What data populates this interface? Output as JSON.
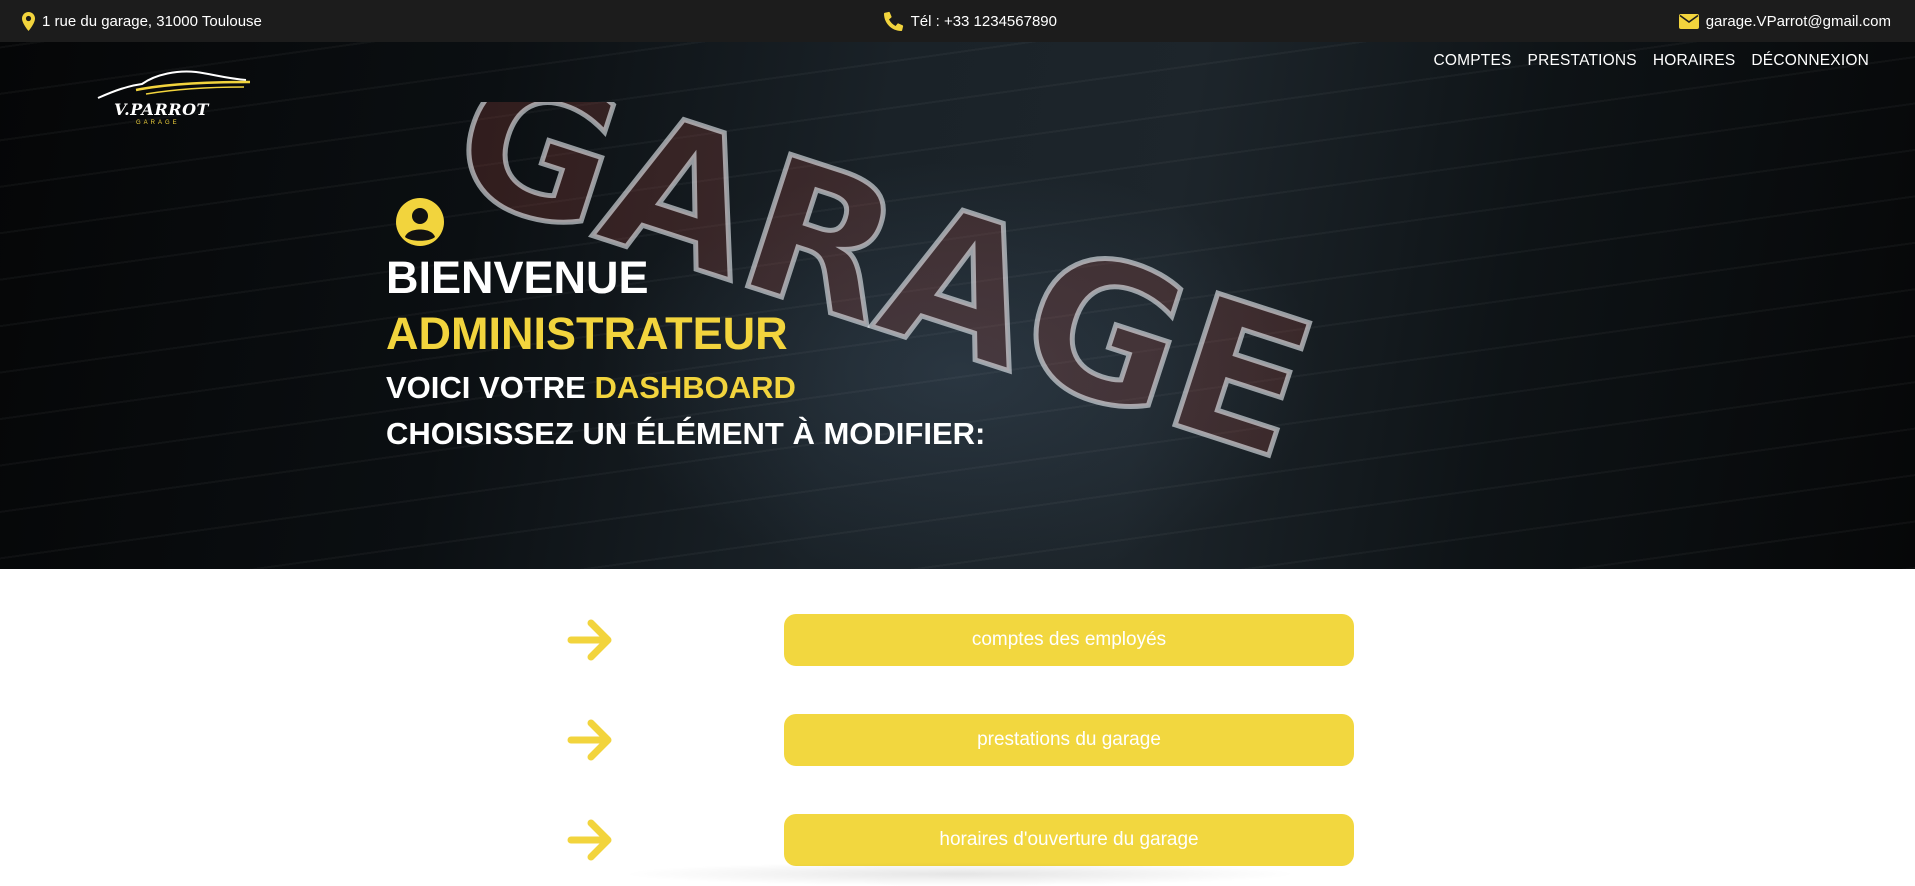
{
  "topbar": {
    "address": "1 rue du garage, 31000 Toulouse",
    "phone": "Tél : +33 1234567890",
    "email": "garage.VParrot@gmail.com",
    "icons": [
      "location-pin-icon",
      "phone-icon",
      "envelope-icon"
    ]
  },
  "logo": {
    "brand": "V.PARROT",
    "sub": "GARAGE"
  },
  "nav": {
    "items": [
      "COMPTES",
      "PRESTATIONS",
      "HORAIRES",
      "DÉCONNEXION"
    ]
  },
  "hero": {
    "neon_sign": "GARAGE",
    "welcome": "BIENVENUE",
    "role": "ADMINISTRATEUR",
    "dashboard_prefix": "VOICI VOTRE",
    "dashboard_accent": "DASHBOARD",
    "instruction": "CHOISISSEZ UN ÉLÉMENT À MODIFIER:"
  },
  "actions": [
    {
      "label": "comptes des employés"
    },
    {
      "label": "prestations du garage"
    },
    {
      "label": "horaires d'ouverture du garage"
    }
  ],
  "colors": {
    "accent": "#f2d43d",
    "button": "#f2d73f",
    "topbar": "#1c1c1c",
    "text_light": "#ffffff"
  }
}
